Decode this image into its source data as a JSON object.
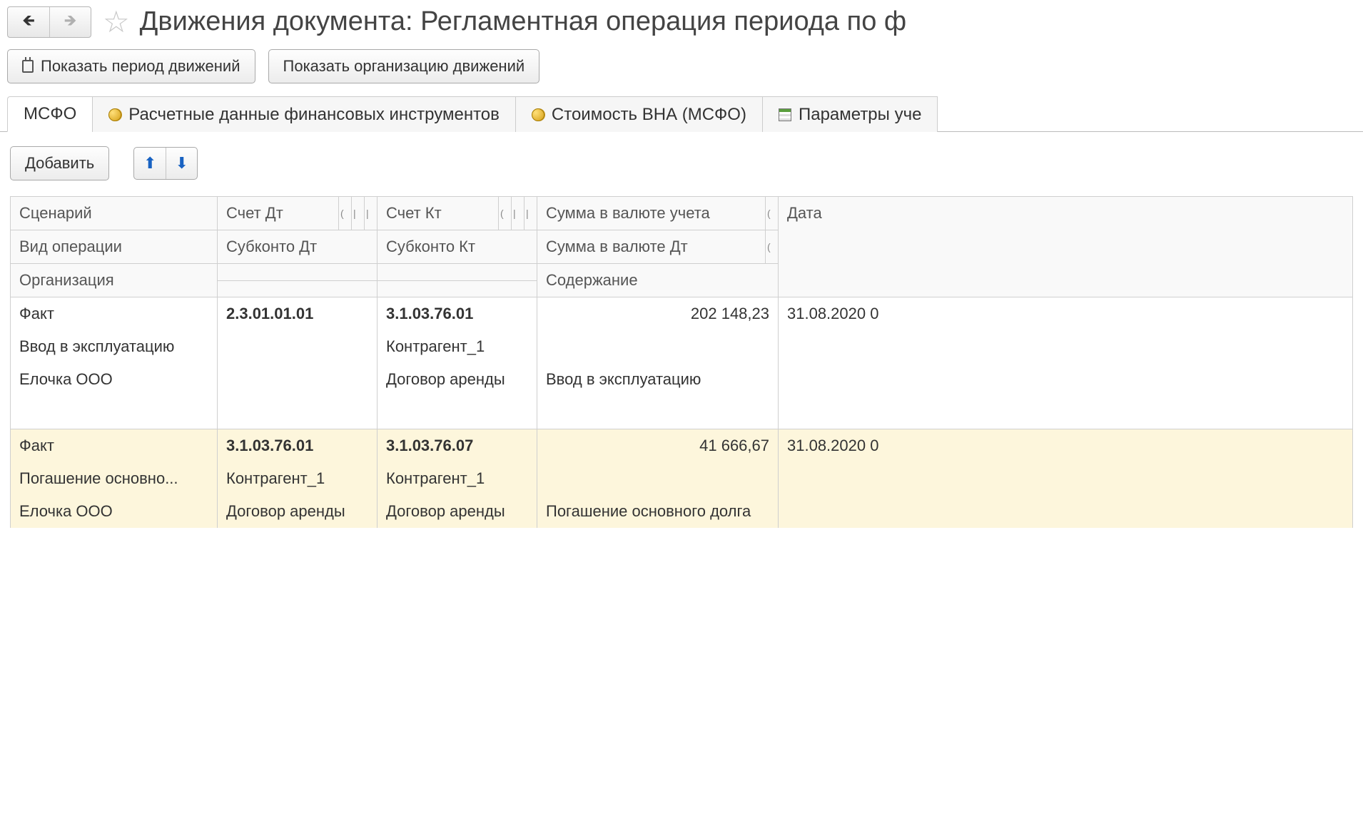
{
  "header": {
    "title": "Движения документа: Регламентная операция периода по ф"
  },
  "toolbar": {
    "show_period": "Показать период движений",
    "show_org": "Показать организацию движений"
  },
  "tabs": [
    {
      "label": "МСФО"
    },
    {
      "label": "Расчетные данные финансовых инструментов"
    },
    {
      "label": "Стоимость ВНА (МСФО)"
    },
    {
      "label": "Параметры уче"
    }
  ],
  "tab_toolbar": {
    "add": "Добавить"
  },
  "grid": {
    "header": {
      "r1": {
        "scenario": "Сценарий",
        "acc_dt": "Счет Дт",
        "acc_kt": "Счет Кт",
        "sum_acc": "Сумма в валюте учета",
        "date": "Дата"
      },
      "r2": {
        "op_type": "Вид операции",
        "sub_dt": "Субконто Дт",
        "sub_kt": "Субконто Кт",
        "sum_dt": "Сумма в валюте Дт"
      },
      "r3": {
        "org": "Организация",
        "content": "Содержание"
      }
    },
    "rows": [
      {
        "r1": {
          "scenario": "Факт",
          "acc_dt": "2.3.01.01.01",
          "acc_kt": "3.1.03.76.01",
          "sum": "202 148,23",
          "date": "31.08.2020 0"
        },
        "r2": {
          "op_type": "Ввод в эксплуатацию",
          "sub_dt": "",
          "sub_kt": "Контрагент_1",
          "sum_dt": ""
        },
        "r3": {
          "org": "Елочка ООО",
          "sub_dt2": "",
          "sub_kt2": "Договор аренды",
          "content": "Ввод в эксплуатацию"
        }
      },
      {
        "r1": {
          "scenario": "Факт",
          "acc_dt": "3.1.03.76.01",
          "acc_kt": "3.1.03.76.07",
          "sum": "41 666,67",
          "date": "31.08.2020 0"
        },
        "r2": {
          "op_type": "Погашение основно...",
          "sub_dt": "Контрагент_1",
          "sub_kt": "Контрагент_1",
          "sum_dt": ""
        },
        "r3": {
          "org": "Елочка ООО",
          "sub_dt2": "Договор аренды",
          "sub_kt2": "Договор аренды",
          "content": "Погашение основного долга"
        }
      }
    ]
  }
}
